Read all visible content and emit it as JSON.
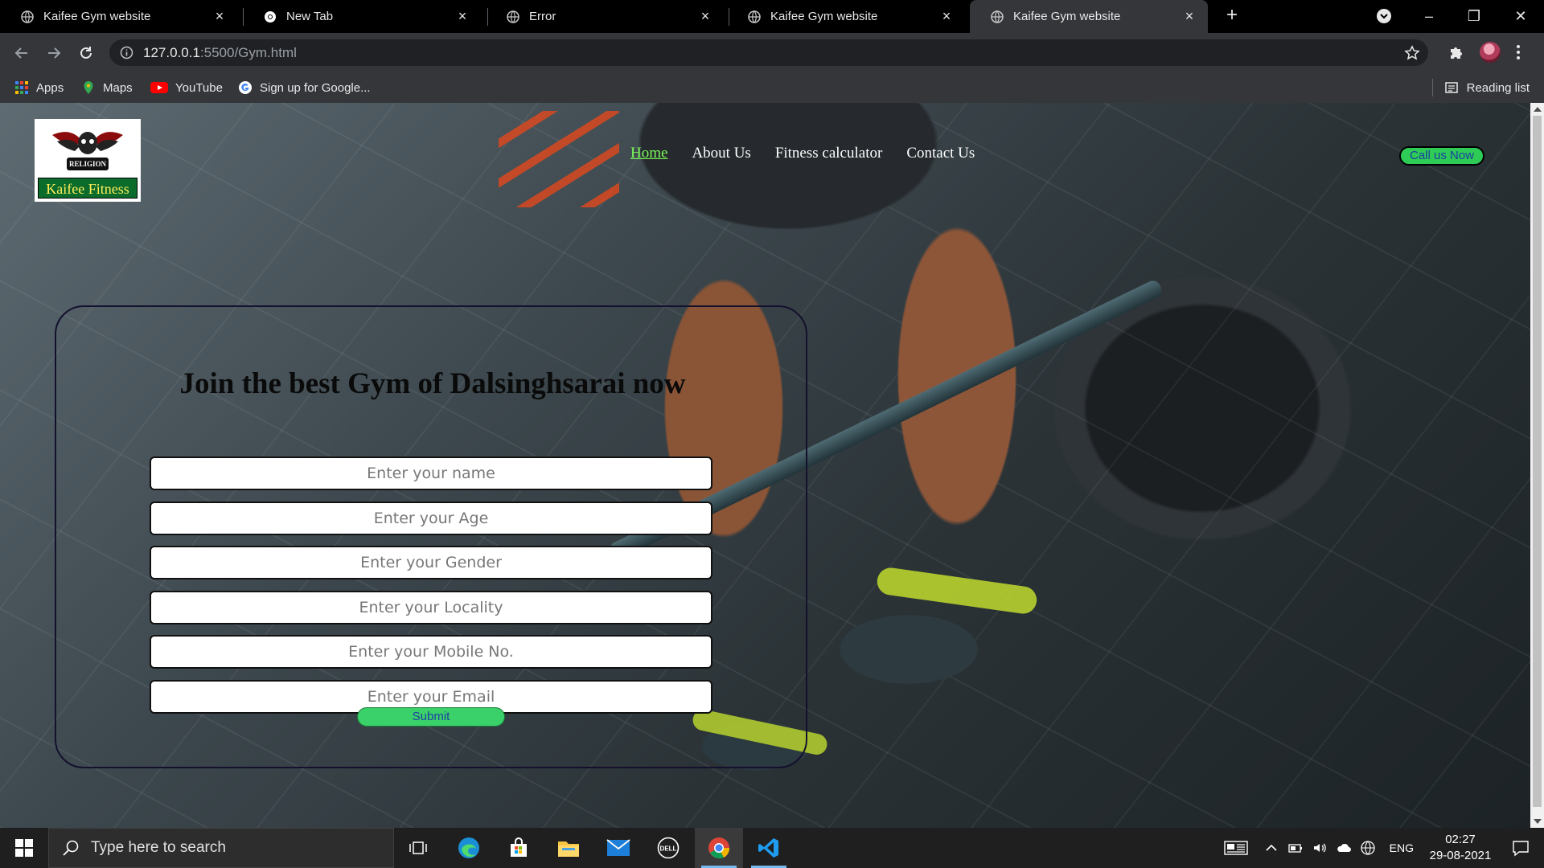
{
  "browser": {
    "tabs": [
      {
        "title": "Kaifee Gym website",
        "active": false
      },
      {
        "title": "New Tab",
        "active": false
      },
      {
        "title": "Error",
        "active": false
      },
      {
        "title": "Kaifee Gym website",
        "active": false
      },
      {
        "title": "Kaifee Gym website",
        "active": true
      }
    ],
    "url_host": "127.0.0.1",
    "url_path": ":5500/Gym.html",
    "bookmarks": [
      {
        "label": "Apps",
        "icon": "apps-grid-icon"
      },
      {
        "label": "Maps",
        "icon": "maps-pin-icon"
      },
      {
        "label": "YouTube",
        "icon": "youtube-icon"
      },
      {
        "label": "Sign up for Google...",
        "icon": "google-icon"
      }
    ],
    "reading_list": "Reading list"
  },
  "site": {
    "logo_caption": "Kaifee Fitness",
    "logo_emblem_text": "RELIGION",
    "nav": [
      {
        "label": "Home",
        "current": true
      },
      {
        "label": "About Us",
        "current": false
      },
      {
        "label": "Fitness calculator",
        "current": false
      },
      {
        "label": "Contact Us",
        "current": false
      }
    ],
    "call_button": "Call us Now",
    "form": {
      "heading": "Join the best Gym of Dalsinghsarai now",
      "fields": [
        {
          "placeholder": "Enter your name"
        },
        {
          "placeholder": "Enter your Age"
        },
        {
          "placeholder": "Enter your Gender"
        },
        {
          "placeholder": "Enter your Locality"
        },
        {
          "placeholder": "Enter your Mobile No."
        },
        {
          "placeholder": "Enter your Email"
        }
      ],
      "submit": "Submit"
    }
  },
  "taskbar": {
    "search_placeholder": "Type here to search",
    "apps": [
      "task-view-icon",
      "edge-icon",
      "store-icon",
      "file-explorer-icon",
      "mail-icon",
      "dell-icon",
      "chrome-icon",
      "vscode-icon"
    ],
    "language": "ENG",
    "time": "02:27",
    "date": "29-08-2021"
  },
  "colors": {
    "chrome_dark": "#35363a",
    "omnibox": "#202124",
    "nav_active": "#7cfc5c",
    "button_green": "#2ecc57",
    "logo_green": "#0b6b2b"
  }
}
